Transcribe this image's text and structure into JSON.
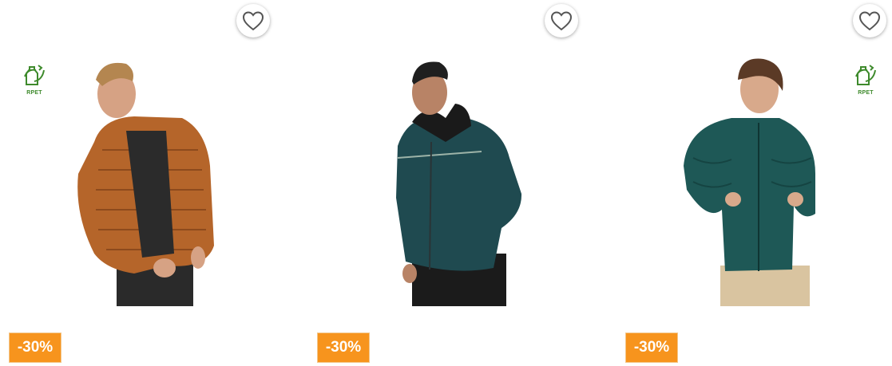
{
  "products": [
    {
      "discount": "-30%",
      "eco_badge": "RPET",
      "jacket_color": "#b5652a",
      "has_eco": true
    },
    {
      "discount": "-30%",
      "jacket_color": "#1f4a50",
      "has_eco": false
    },
    {
      "discount": "-30%",
      "eco_badge": "RPET",
      "jacket_color": "#1e5856",
      "has_eco": true
    }
  ],
  "colors": {
    "badge": "#f7941d",
    "eco": "#3e8a2c"
  },
  "icons": {
    "favorite": "heart-outline-icon",
    "eco": "recycle-bottle-icon"
  }
}
